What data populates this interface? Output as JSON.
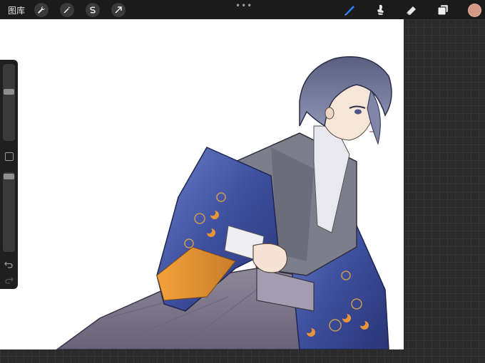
{
  "toolbar": {
    "gallery_label": "图库",
    "tools": [
      {
        "name": "wrench-icon"
      },
      {
        "name": "magic-wand-icon"
      },
      {
        "name": "selection-icon"
      },
      {
        "name": "transform-arrow-icon"
      }
    ],
    "right_tools": [
      {
        "name": "brush-icon",
        "active": true
      },
      {
        "name": "smudge-icon"
      },
      {
        "name": "eraser-icon"
      },
      {
        "name": "layers-icon"
      }
    ],
    "color_swatch": "#d49a86",
    "accent": "#2e7cf6"
  },
  "sidebar": {
    "brush_size_level": 0.35,
    "opacity_level": 0.02
  },
  "canvas": {
    "artwork": "illustration"
  }
}
